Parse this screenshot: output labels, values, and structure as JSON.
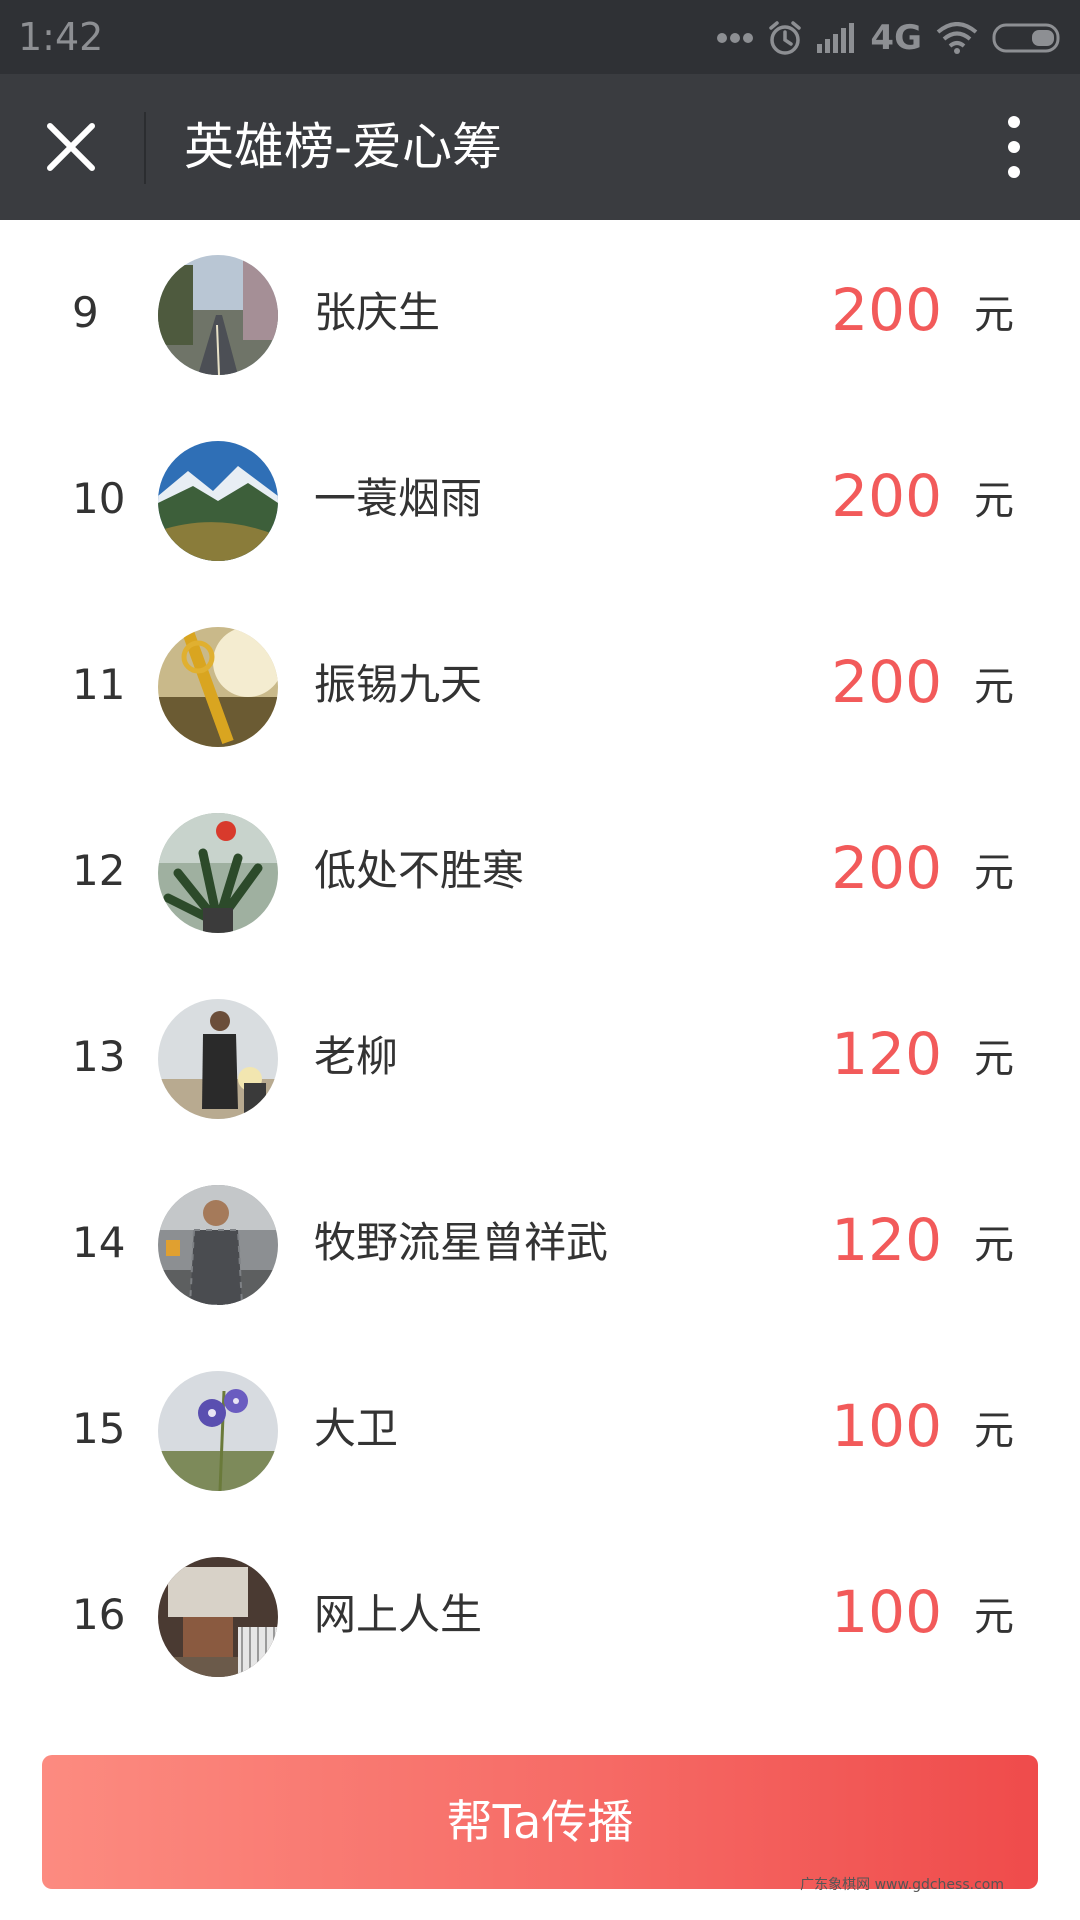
{
  "status_bar": {
    "time": "1:42",
    "network": "4G"
  },
  "nav": {
    "title": "英雄榜-爱心筹"
  },
  "donors": [
    {
      "rank": "9",
      "name": "张庆生",
      "amount": "200",
      "unit": "元"
    },
    {
      "rank": "10",
      "name": "一蓑烟雨",
      "amount": "200",
      "unit": "元"
    },
    {
      "rank": "11",
      "name": "振锡九天",
      "amount": "200",
      "unit": "元"
    },
    {
      "rank": "12",
      "name": "低处不胜寒",
      "amount": "200",
      "unit": "元"
    },
    {
      "rank": "13",
      "name": "老柳",
      "amount": "120",
      "unit": "元"
    },
    {
      "rank": "14",
      "name": "牧野流星曾祥武",
      "amount": "120",
      "unit": "元"
    },
    {
      "rank": "15",
      "name": "大卫",
      "amount": "100",
      "unit": "元"
    },
    {
      "rank": "16",
      "name": "网上人生",
      "amount": "100",
      "unit": "元"
    }
  ],
  "share_button": {
    "label": "帮Ta传播"
  },
  "watermark": "广东象棋网 www.gdchess.com",
  "colors": {
    "amount": "#f25a5a",
    "nav_background": "#3a3c40",
    "status_background": "#2f3135",
    "button_start": "#fc8b80",
    "button_end": "#ef4b4b"
  }
}
